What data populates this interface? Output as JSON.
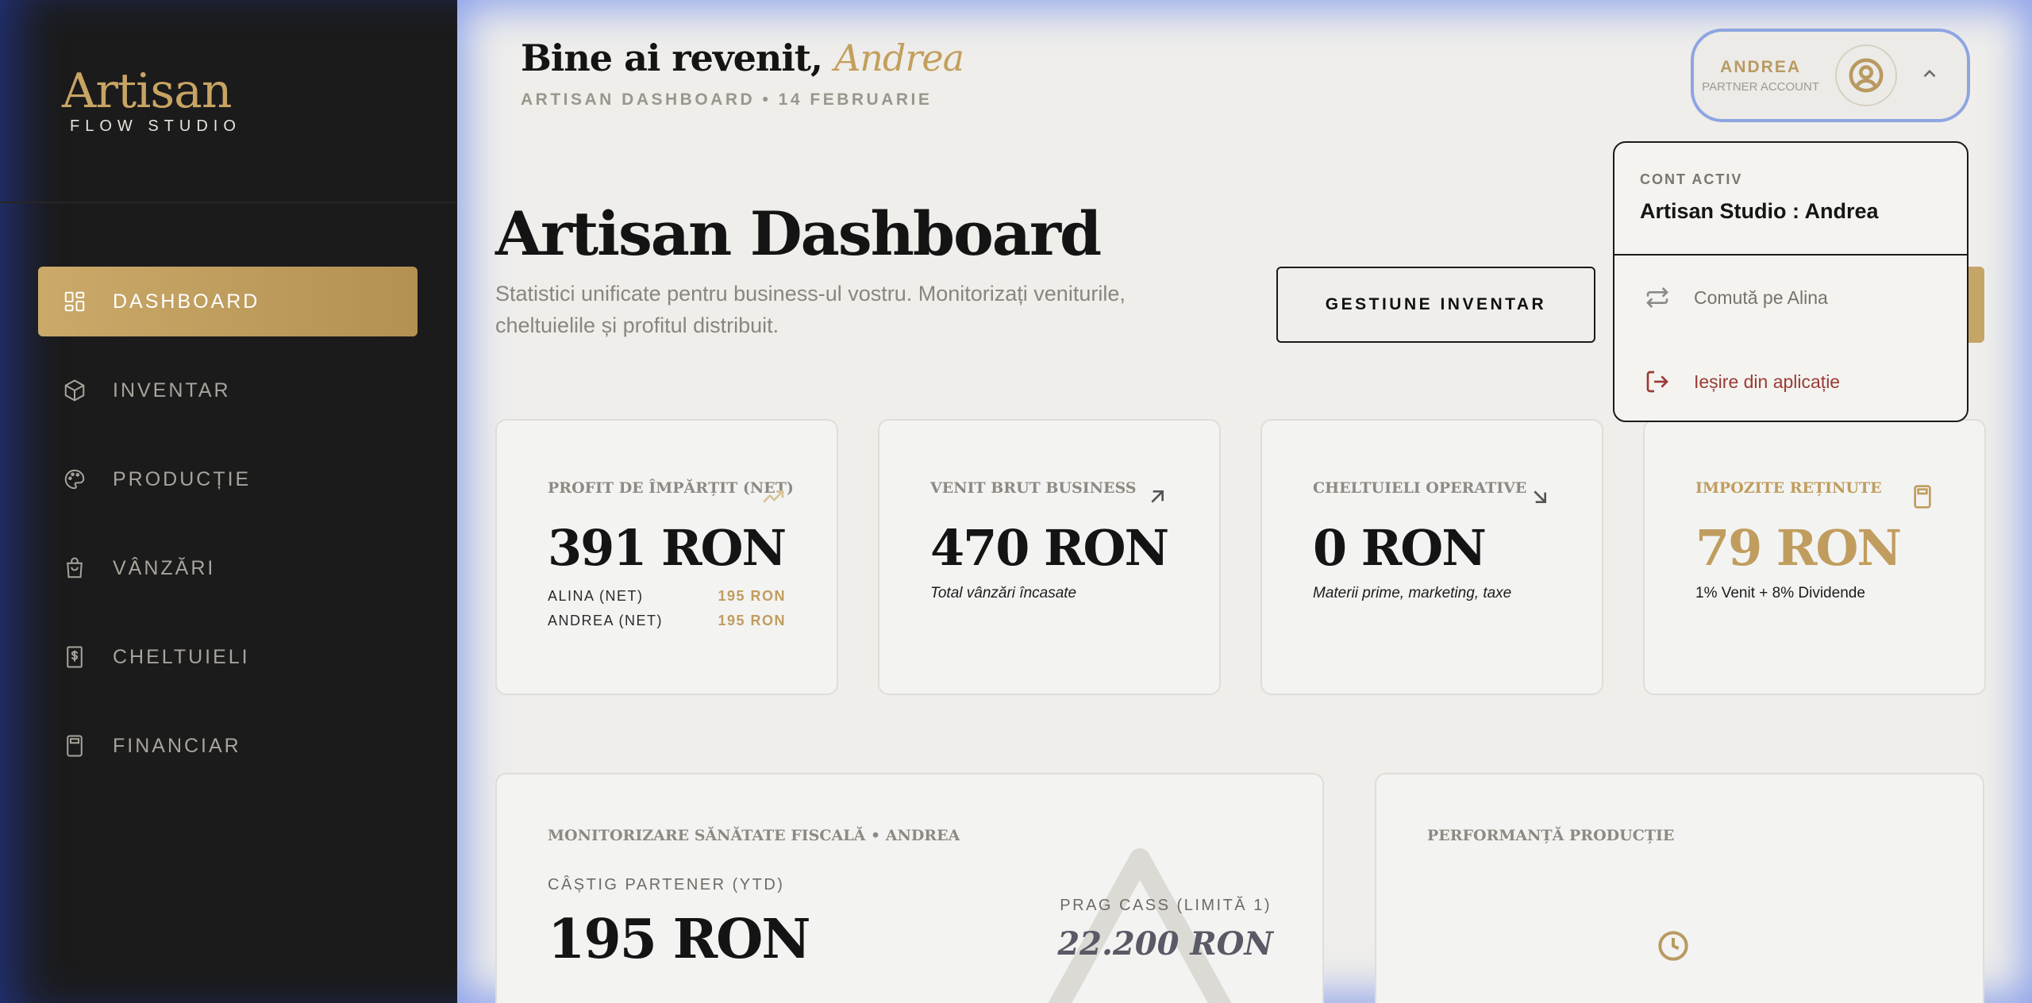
{
  "sidebar": {
    "logo_main": "Artisan",
    "logo_sub": "FLOW STUDIO",
    "items": [
      {
        "label": "DASHBOARD",
        "icon": "dashboard-grid-icon",
        "active": true
      },
      {
        "label": "INVENTAR",
        "icon": "box-icon"
      },
      {
        "label": "PRODUCȚIE",
        "icon": "palette-icon"
      },
      {
        "label": "VÂNZĂRI",
        "icon": "shopping-bag-icon"
      },
      {
        "label": "CHELTUIELI",
        "icon": "dollar-receipt-icon"
      },
      {
        "label": "FINANCIAR",
        "icon": "calculator-icon"
      }
    ]
  },
  "header": {
    "welcome_prefix": "Bine ai revenit,",
    "welcome_name": "Andrea",
    "subtitle": "ARTISAN DASHBOARD • 14 FEBRUARIE"
  },
  "account": {
    "name": "ANDREA",
    "role": "PARTNER ACCOUNT"
  },
  "dropdown": {
    "label": "CONT ACTIV",
    "title": "Artisan Studio : Andrea",
    "switch_label": "Comută pe Alina",
    "logout_label": "Ieșire din aplicație"
  },
  "page": {
    "title": "Artisan Dashboard",
    "description": "Statistici unificate pentru business-ul vostru. Monitorizați veniturile, cheltuielile și profitul distribuit.",
    "inventory_button": "GESTIUNE INVENTAR"
  },
  "stats": [
    {
      "label": "PROFIT DE ÎMPĂRȚIT (NET)",
      "value": "391 RON",
      "icon": "trending-up-icon",
      "split": [
        {
          "name": "ALINA (NET)",
          "amount": "195 RON"
        },
        {
          "name": "ANDREA (NET)",
          "amount": "195 RON"
        }
      ]
    },
    {
      "label": "VENIT BRUT BUSINESS",
      "value": "470 RON",
      "note": "Total vânzări încasate",
      "icon": "arrow-up-right-icon"
    },
    {
      "label": "CHELTUIELI OPERATIVE",
      "value": "0 RON",
      "note": "Materii prime, marketing, taxe",
      "icon": "arrow-down-right-icon"
    },
    {
      "label": "IMPOZITE REȚINUTE",
      "value": "79 RON",
      "note": "1% Venit + 8% Dividende",
      "icon": "calculator-icon"
    }
  ],
  "fiscal": {
    "label": "MONITORIZARE SĂNĂTATE FISCALĂ • ANDREA",
    "earn_label": "CÂȘTIG PARTENER (YTD)",
    "earn_value": "195 RON",
    "prag_label": "PRAG CASS (LIMITĂ 1)",
    "prag_value": "22.200 RON"
  },
  "production": {
    "label": "PERFORMANȚĂ PRODUCȚIE"
  },
  "colors": {
    "gold": "#c4a467",
    "dark": "#1b1b1b",
    "danger": "#9a3b35"
  }
}
